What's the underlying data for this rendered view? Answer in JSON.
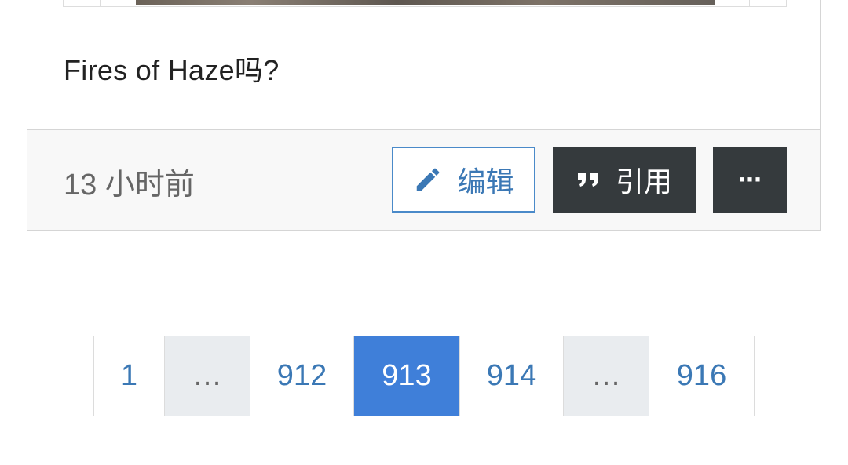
{
  "post": {
    "text": "Fires of Haze吗?",
    "timestamp": "13 小时前",
    "buttons": {
      "edit_label": "编辑",
      "quote_label": "引用",
      "more_label": "···"
    },
    "icons": {
      "edit": "pencil-icon",
      "quote": "quote-icon",
      "more": "more-horizontal-icon"
    }
  },
  "pagination": {
    "items": [
      {
        "label": "1",
        "type": "page"
      },
      {
        "label": "…",
        "type": "ellipsis"
      },
      {
        "label": "912",
        "type": "page"
      },
      {
        "label": "913",
        "type": "active"
      },
      {
        "label": "914",
        "type": "page"
      },
      {
        "label": "…",
        "type": "ellipsis"
      },
      {
        "label": "916",
        "type": "page"
      }
    ]
  },
  "colors": {
    "accent_blue": "#3f7fd9",
    "link_blue": "#3b78b5",
    "dark_button": "#353a3d"
  }
}
